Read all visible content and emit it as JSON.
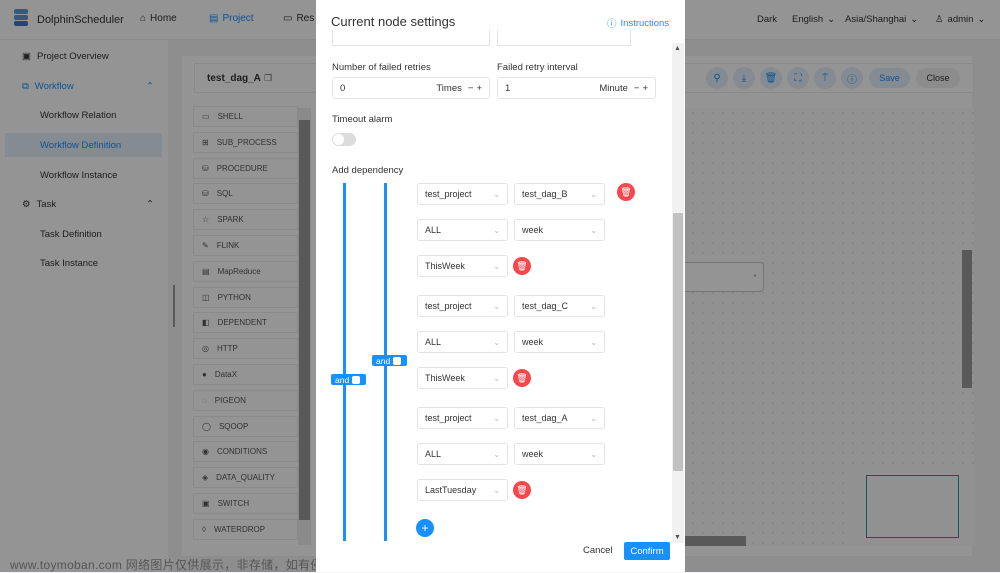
{
  "header": {
    "logo": "DolphinScheduler",
    "nav": [
      {
        "label": "Home",
        "icon": "home-icon"
      },
      {
        "label": "Project",
        "icon": "project-icon"
      },
      {
        "label": "Res",
        "icon": "folder-icon"
      }
    ],
    "theme": "Dark",
    "language": "English",
    "timezone": "Asia/Shanghai",
    "user": "admin"
  },
  "sidebar": {
    "items": [
      {
        "label": "Project Overview"
      },
      {
        "label": "Workflow"
      },
      {
        "label": "Workflow Relation"
      },
      {
        "label": "Workflow Definition"
      },
      {
        "label": "Workflow Instance"
      },
      {
        "label": "Task"
      },
      {
        "label": "Task Definition"
      },
      {
        "label": "Task Instance"
      }
    ]
  },
  "workflow": {
    "name": "test_dag_A",
    "save": "Save",
    "close": "Close"
  },
  "tasks": [
    "SHELL",
    "SUB_PROCESS",
    "PROCEDURE",
    "SQL",
    "SPARK",
    "FLINK",
    "MapReduce",
    "PYTHON",
    "DEPENDENT",
    "HTTP",
    "DataX",
    "PIGEON",
    "SQOOP",
    "CONDITIONS",
    "DATA_QUALITY",
    "SWITCH",
    "WATERDROP"
  ],
  "modal": {
    "title": "Current node settings",
    "instructions": "Instructions",
    "retries": {
      "label": "Number of failed retries",
      "value": "0",
      "unit": "Times"
    },
    "interval": {
      "label": "Failed retry interval",
      "value": "1",
      "unit": "Minute"
    },
    "timeout": {
      "label": "Timeout alarm",
      "enabled": false
    },
    "dependency": {
      "label": "Add dependency",
      "outer_relation": "and",
      "inner_relation": "and",
      "items": [
        {
          "project": "test_project",
          "workflow": "test_dag_B",
          "task": "ALL",
          "cycle": "week",
          "date": "ThisWeek"
        },
        {
          "project": "test_project",
          "workflow": "test_dag_C",
          "task": "ALL",
          "cycle": "week",
          "date": "ThisWeek"
        },
        {
          "project": "test_project",
          "workflow": "test_dag_A",
          "task": "ALL",
          "cycle": "week",
          "date": "LastTuesday"
        }
      ]
    },
    "cancel": "Cancel",
    "confirm": "Confirm"
  },
  "watermark": "www.toymoban.com 网络图片仅供展示，非存储，如有侵权请联系删除。",
  "colors": {
    "primary": "#1890ff",
    "danger": "#f5484d",
    "minimap": "#1a9e96"
  }
}
